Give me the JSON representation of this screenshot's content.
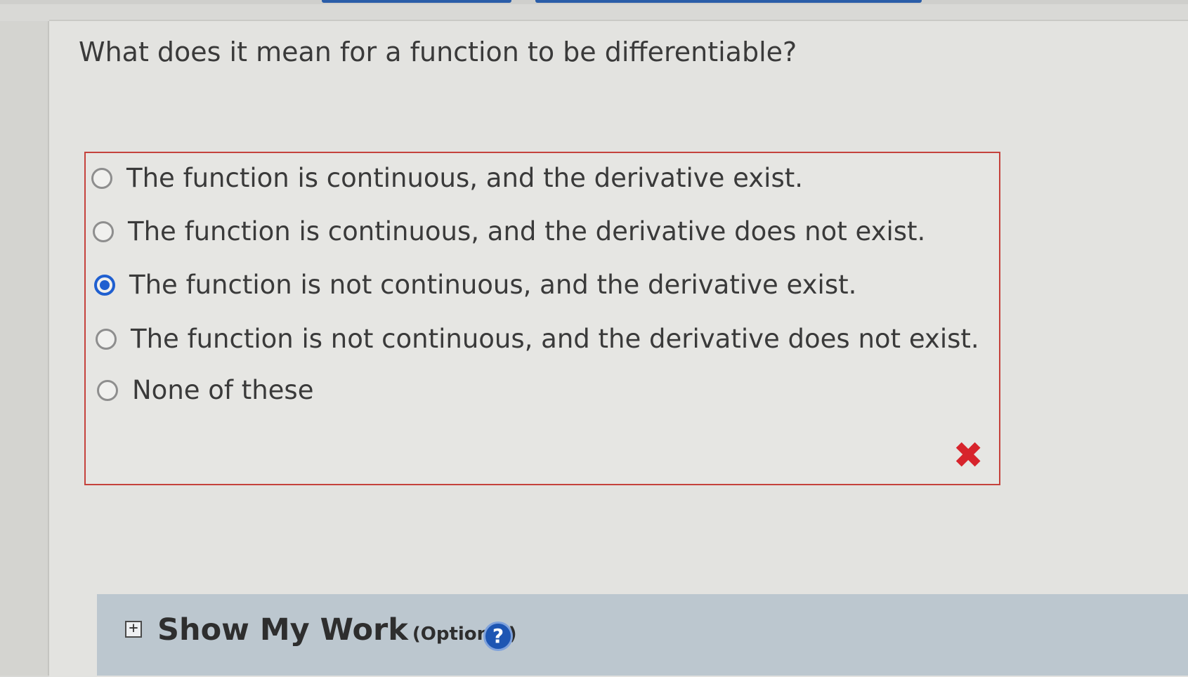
{
  "question": {
    "text": "What does it mean for a function to be differentiable?"
  },
  "answer_options": [
    {
      "label": "The function is continuous, and the derivative exist.",
      "selected": false
    },
    {
      "label": "The function is continuous, and the derivative does not exist.",
      "selected": false
    },
    {
      "label": "The function is not continuous, and the derivative exist.",
      "selected": true
    },
    {
      "label": "The function is not continuous, and the derivative does not exist.",
      "selected": false
    },
    {
      "label": "None of these",
      "selected": false
    }
  ],
  "result": {
    "status": "incorrect",
    "icon": "x-mark-icon",
    "mark_glyph": "✖",
    "color": "#d7242c"
  },
  "show_my_work": {
    "expand_glyph": "+",
    "title": "Show My Work",
    "optional_label": "(Optional)",
    "help_glyph": "?"
  },
  "colors": {
    "selection_accent": "#1f5fd0",
    "error_border": "#c5423c",
    "work_bar_bg": "#bcc7cf"
  }
}
